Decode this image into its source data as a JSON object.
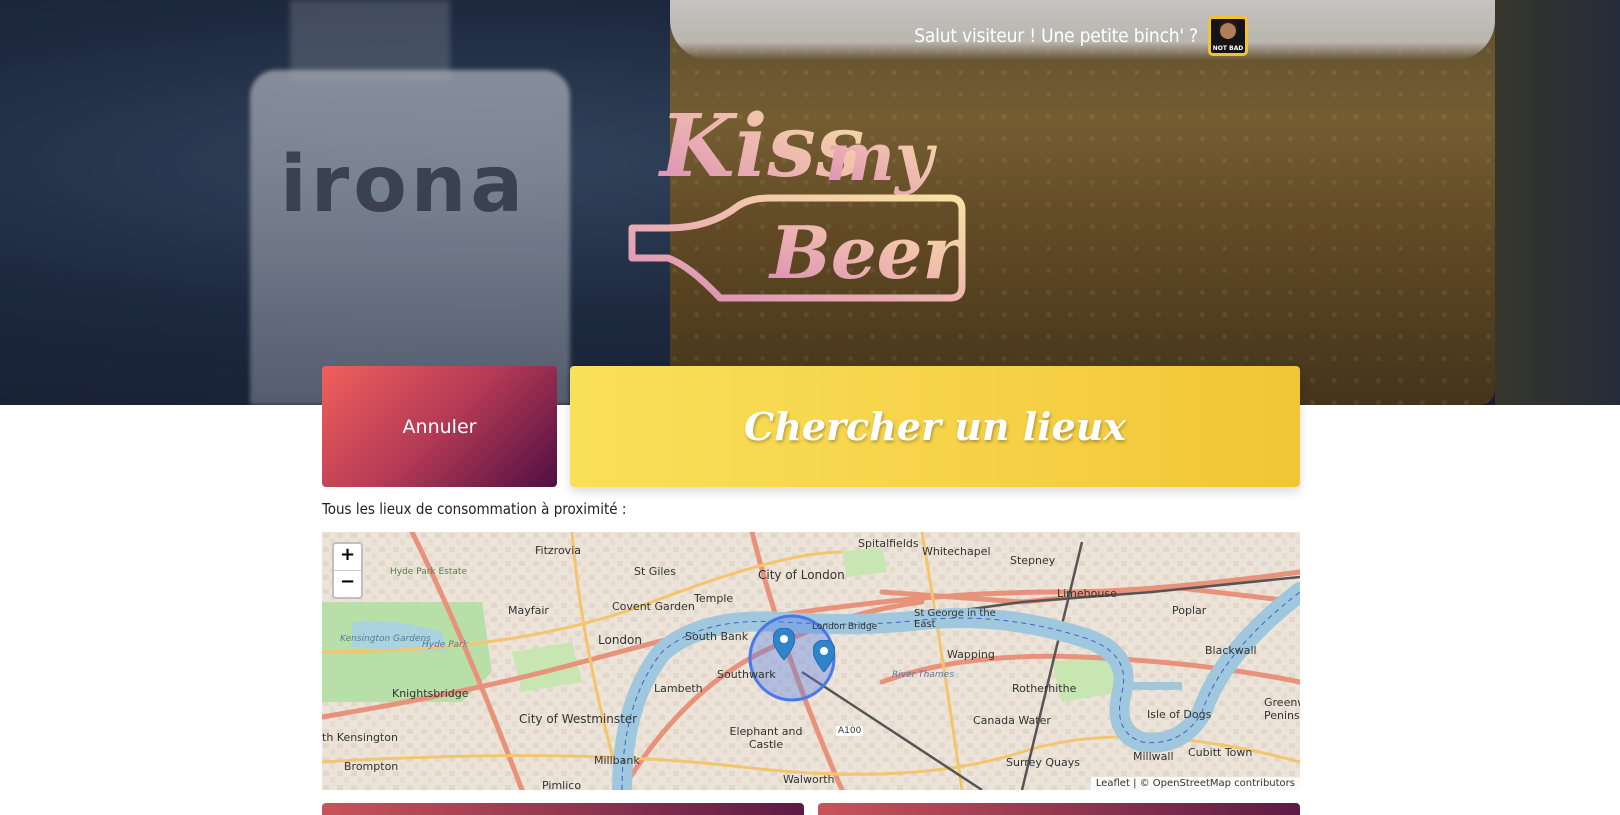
{
  "header": {
    "greeting": "Salut visiteur ! Une petite binch' ?",
    "avatar_icon": "not-bad-meme-avatar",
    "avatar_caption": "NOT BAD",
    "logo_text": "Kiss my Beer"
  },
  "actions": {
    "cancel_label": "Annuler",
    "search_label": "Chercher un lieux"
  },
  "section": {
    "label": "Tous les lieux de consommation à proximité :"
  },
  "map": {
    "zoom_in": "+",
    "zoom_out": "−",
    "attribution_leaflet": "Leaflet",
    "attribution_osm": "© OpenStreetMap contributors",
    "places": {
      "fitzrovia": "Fitzrovia",
      "st_giles": "St Giles",
      "city_of_london": "City of London",
      "spitalfields": "Spitalfields",
      "whitechapel": "Whitechapel",
      "stepney": "Stepney",
      "hyde_park_estate": "Hyde Park Estate",
      "covent_garden": "Covent Garden",
      "temple": "Temple",
      "mayfair": "Mayfair",
      "limehouse": "Limehouse",
      "poplar": "Poplar",
      "st_george_east": "St George in the East",
      "london": "London",
      "south_bank": "South Bank",
      "london_bridge": "London Bridge",
      "wapping": "Wapping",
      "blackwall": "Blackwall",
      "kensington_gardens": "Kensington Gardens",
      "hyde_park": "Hyde Park",
      "knightsbridge": "Knightsbridge",
      "lambeth": "Lambeth",
      "southwark": "Southwark",
      "rotherhithe": "Rotherhithe",
      "city_of_westminster": "City of Westminster",
      "canada_water": "Canada Water",
      "isle_of_dogs": "Isle of Dogs",
      "greenwich_peninsula": "Greenw Peninsu",
      "south_kensington": "th Kensington",
      "elephant_castle": "Elephant and Castle",
      "millwall": "Millwall",
      "cubitt_town": "Cubitt Town",
      "brompton": "Brompton",
      "millbank": "Millbank",
      "surrey_quays": "Surrey Quays",
      "walworth": "Walworth",
      "pimlico": "Pimlico",
      "a100": "A100",
      "river_thames": "River Thames"
    },
    "markers": [
      "map-marker-icon",
      "map-marker-icon"
    ],
    "radius_circle_color": "#4a78e8"
  },
  "colors": {
    "cancel_gradient": [
      "#f0605a",
      "#4f0f42"
    ],
    "search_gradient": [
      "#f9e05a",
      "#f1c535"
    ],
    "logo_gradient": [
      "#e59bb8",
      "#f7d9a8"
    ]
  }
}
